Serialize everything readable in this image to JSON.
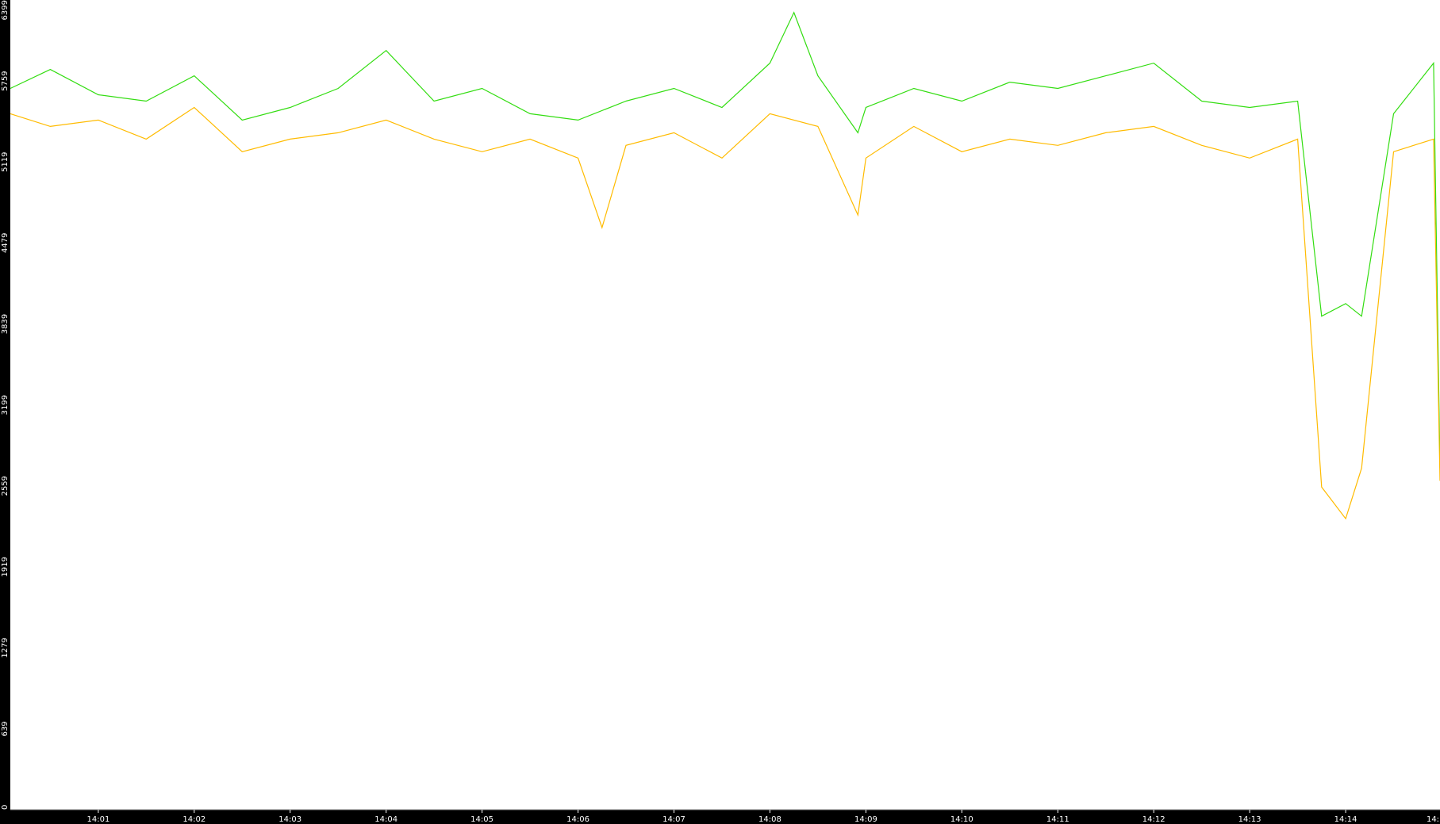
{
  "chart_data": {
    "type": "line",
    "title": "",
    "xlabel": "",
    "ylabel": "",
    "ylim": [
      0,
      6399
    ],
    "y_ticks": [
      "6399",
      "5759",
      "5119",
      "4479",
      "3839",
      "3199",
      "2559",
      "1919",
      "1279",
      "639",
      "0"
    ],
    "x_tick_labels": [
      "14:01",
      "14:02",
      "14:03",
      "14:04",
      "14:05",
      "14:06",
      "14:07",
      "14:08",
      "14:09",
      "14:10",
      "14:11",
      "14:12",
      "14:13",
      "14:14",
      "14:"
    ],
    "x_range": [
      "14:00:05",
      "14:14:59"
    ],
    "grid": false,
    "legend": "none",
    "series": [
      {
        "color": "#33dd11",
        "x": [
          "14:00:05",
          "14:00:30",
          "14:01:00",
          "14:01:30",
          "14:02:00",
          "14:02:30",
          "14:03:00",
          "14:03:30",
          "14:04:00",
          "14:04:30",
          "14:05:00",
          "14:05:30",
          "14:06:00",
          "14:06:30",
          "14:07:00",
          "14:07:30",
          "14:08:00",
          "14:08:15",
          "14:08:30",
          "14:08:55",
          "14:09:00",
          "14:09:30",
          "14:10:00",
          "14:10:30",
          "14:11:00",
          "14:11:30",
          "14:12:00",
          "14:12:30",
          "14:13:00",
          "14:13:30",
          "14:13:45",
          "14:14:00",
          "14:14:10",
          "14:14:30",
          "14:14:55",
          "14:14:59"
        ],
        "values": [
          5700,
          5850,
          5650,
          5600,
          5800,
          5450,
          5550,
          5700,
          6000,
          5600,
          5700,
          5500,
          5450,
          5600,
          5700,
          5550,
          5900,
          6300,
          5800,
          5350,
          5550,
          5700,
          5600,
          5750,
          5700,
          5800,
          5900,
          5600,
          5550,
          5600,
          3900,
          4000,
          3900,
          5500,
          5900,
          2700
        ]
      },
      {
        "color": "#ffbb00",
        "x": [
          "14:00:05",
          "14:00:30",
          "14:01:00",
          "14:01:30",
          "14:02:00",
          "14:02:30",
          "14:03:00",
          "14:03:30",
          "14:04:00",
          "14:04:30",
          "14:05:00",
          "14:05:30",
          "14:06:00",
          "14:06:15",
          "14:06:30",
          "14:07:00",
          "14:07:30",
          "14:08:00",
          "14:08:30",
          "14:08:55",
          "14:09:00",
          "14:09:30",
          "14:10:00",
          "14:10:30",
          "14:11:00",
          "14:11:30",
          "14:12:00",
          "14:12:30",
          "14:13:00",
          "14:13:30",
          "14:13:45",
          "14:14:00",
          "14:14:10",
          "14:14:30",
          "14:14:55",
          "14:14:59"
        ],
        "values": [
          5500,
          5400,
          5450,
          5300,
          5550,
          5200,
          5300,
          5350,
          5450,
          5300,
          5200,
          5300,
          5150,
          4600,
          5250,
          5350,
          5150,
          5500,
          5400,
          4700,
          5150,
          5400,
          5200,
          5300,
          5250,
          5350,
          5400,
          5250,
          5150,
          5300,
          2550,
          2300,
          2700,
          5200,
          5300,
          2600
        ]
      }
    ]
  }
}
